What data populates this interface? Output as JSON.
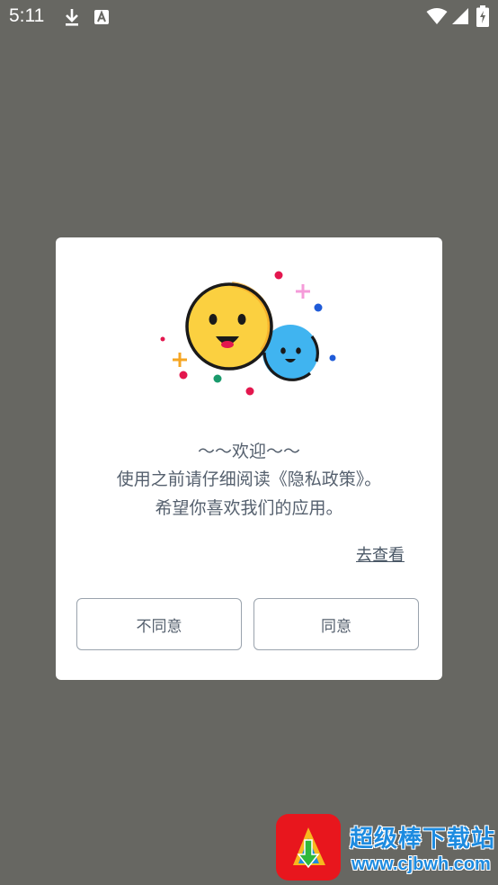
{
  "status_bar": {
    "time": "5:11",
    "icons": [
      "download-icon",
      "a-icon",
      "wifi-icon",
      "signal-icon",
      "battery-charging-icon"
    ]
  },
  "dialog": {
    "welcome_line": "～～欢迎～～",
    "message_line1": "使用之前请仔细阅读《隐私政策》。",
    "message_line2": "希望你喜欢我们的应用。",
    "view_link": "去查看",
    "disagree_button": "不同意",
    "agree_button": "同意"
  },
  "watermark": {
    "title": "超级棒下载站",
    "url": "www.cjbwh.com"
  }
}
